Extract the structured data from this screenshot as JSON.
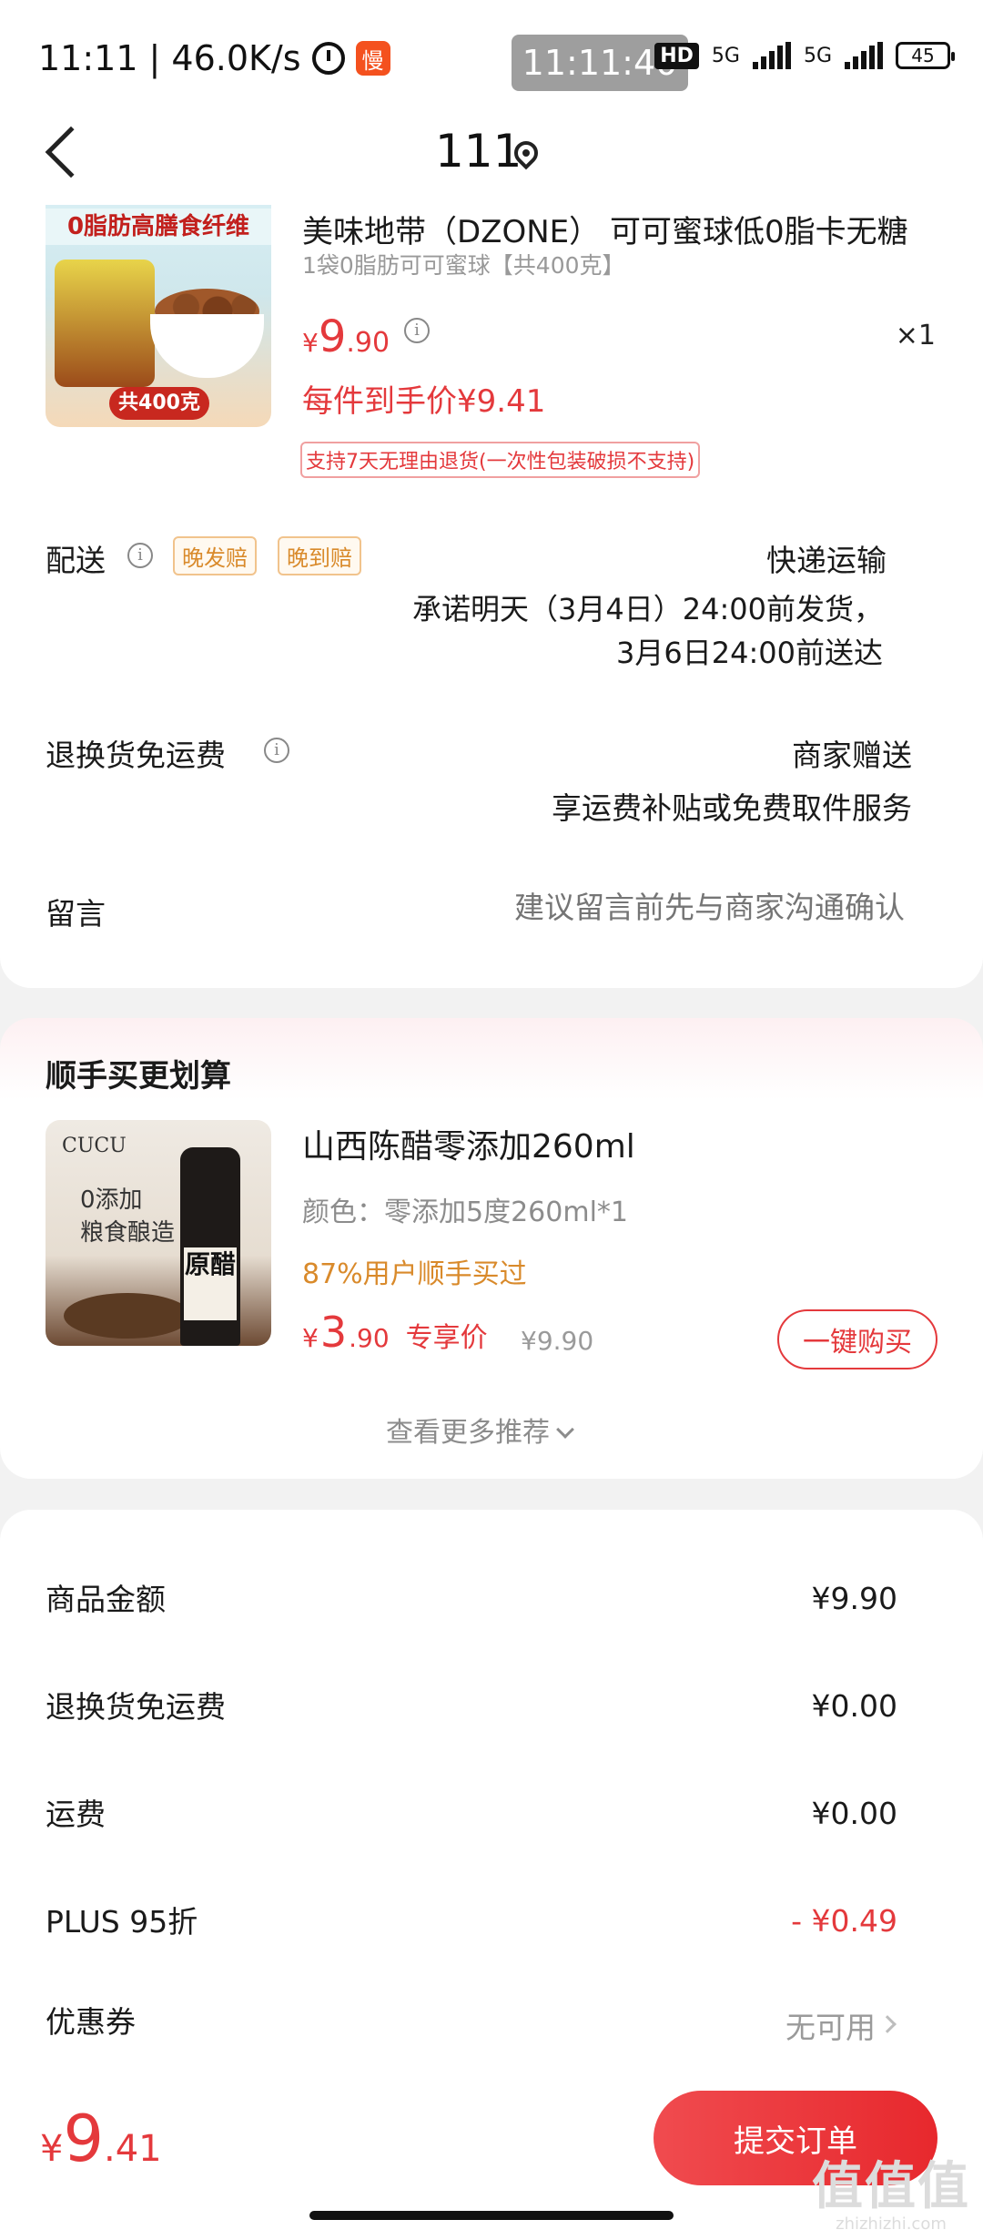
{
  "status_bar": {
    "time": "11:11",
    "speed": "| 46.0K/s",
    "app_badge": "慢",
    "clock": "11:11:40",
    "hd": "HD",
    "net1": "5G",
    "net2": "5G",
    "battery": "45"
  },
  "nav": {
    "title": "111"
  },
  "order": {
    "product_name": "美味地带（DZONE） 可可蜜球低0脂卡无糖",
    "product_spec": "1袋0脂肪可可蜜球【共400克】",
    "image_banner": "0脂肪高膳食纤维",
    "image_tag": "共400克",
    "price_yen": "¥",
    "price_int": "9",
    "price_dec": ".90",
    "info_glyph": "i",
    "quantity": "×1",
    "hand_price": "每件到手价¥9.41",
    "return_tag": "支持7天无理由退货(一次性包装破损不支持)",
    "delivery_label": "配送",
    "tag_late_ship": "晚发赔",
    "tag_late_arrive": "晚到赔",
    "delivery_method": "快递运输",
    "delivery_promise_1": "承诺明天（3月4日）24:00前发货，",
    "delivery_promise_2": "3月6日24:00前送达",
    "free_return_label": "退换货免运费",
    "free_return_value": "商家赠送",
    "free_return_desc": "享运费补贴或免费取件服务",
    "message_label": "留言",
    "message_placeholder": "建议留言前先与商家沟通确认"
  },
  "recommend": {
    "title": "顺手买更划算",
    "image_brand": "CUCU",
    "image_slogan_1": "0添加",
    "image_slogan_2": "粮食酿造",
    "image_label": "原醋",
    "name": "山西陈醋零添加260ml",
    "spec": "颜色：零添加5度260ml*1",
    "buyers": "87%用户顺手买过",
    "price_yen": "¥",
    "price_int": "3",
    "price_dec": ".90",
    "exclusive": "专享价",
    "original_price": "¥9.90",
    "buy_button": "一键购买",
    "more": "查看更多推荐"
  },
  "summary": {
    "rows": [
      {
        "label": "商品金额",
        "value": "¥9.90"
      },
      {
        "label": "退换货免运费",
        "value": "¥0.00"
      },
      {
        "label": "运费",
        "value": "¥0.00"
      },
      {
        "label": "PLUS 95折",
        "value": "- ¥0.49"
      },
      {
        "label": "优惠券",
        "value": "无可用"
      }
    ]
  },
  "bottom": {
    "price_yen": "¥",
    "price_int": "9",
    "price_dec": ".41",
    "submit": "提交订单"
  },
  "watermark": {
    "main": "值值值",
    "site": "zhizhizhi.com"
  },
  "colors": {
    "accent_red": "#e4393c",
    "tag_orange": "#d98a2b",
    "background": "#f2f2f2"
  }
}
